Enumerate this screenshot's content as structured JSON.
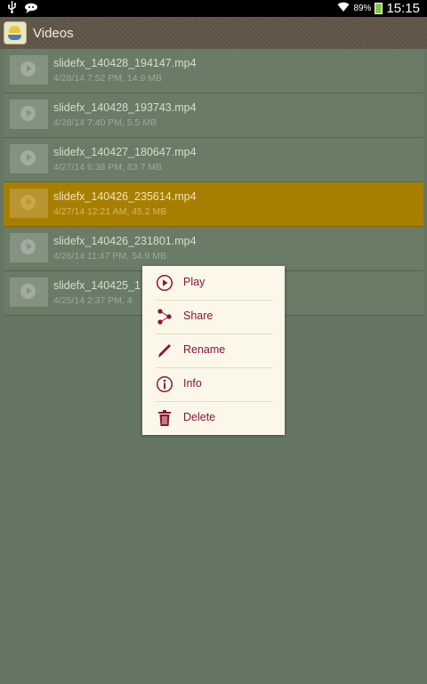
{
  "status_bar": {
    "battery": "89%",
    "time": "15:15"
  },
  "action_bar": {
    "title": "Videos"
  },
  "videos": [
    {
      "name": "slidefx_140428_194147.mp4",
      "meta": "4/28/14 7:52 PM, 14.9 MB",
      "selected": false
    },
    {
      "name": "slidefx_140428_193743.mp4",
      "meta": "4/28/14 7:40 PM, 5.5 MB",
      "selected": false
    },
    {
      "name": "slidefx_140427_180647.mp4",
      "meta": "4/27/14 6:38 PM, 83.7 MB",
      "selected": false
    },
    {
      "name": "slidefx_140426_235614.mp4",
      "meta": "4/27/14 12:21 AM, 45.2 MB",
      "selected": true
    },
    {
      "name": "slidefx_140426_231801.mp4",
      "meta": "4/26/14 11:47 PM, 54.9 MB",
      "selected": false
    },
    {
      "name": "slidefx_140425_1",
      "meta": "4/25/14 2:37 PM, 4",
      "selected": false
    }
  ],
  "context_menu": {
    "items": [
      {
        "label": "Play",
        "icon": "play-icon"
      },
      {
        "label": "Share",
        "icon": "share-icon"
      },
      {
        "label": "Rename",
        "icon": "pencil-icon"
      },
      {
        "label": "Info",
        "icon": "info-icon"
      },
      {
        "label": "Delete",
        "icon": "trash-icon"
      }
    ]
  },
  "colors": {
    "accent": "#8a1538",
    "selected_row": "#a77f00",
    "background": "#657662"
  }
}
